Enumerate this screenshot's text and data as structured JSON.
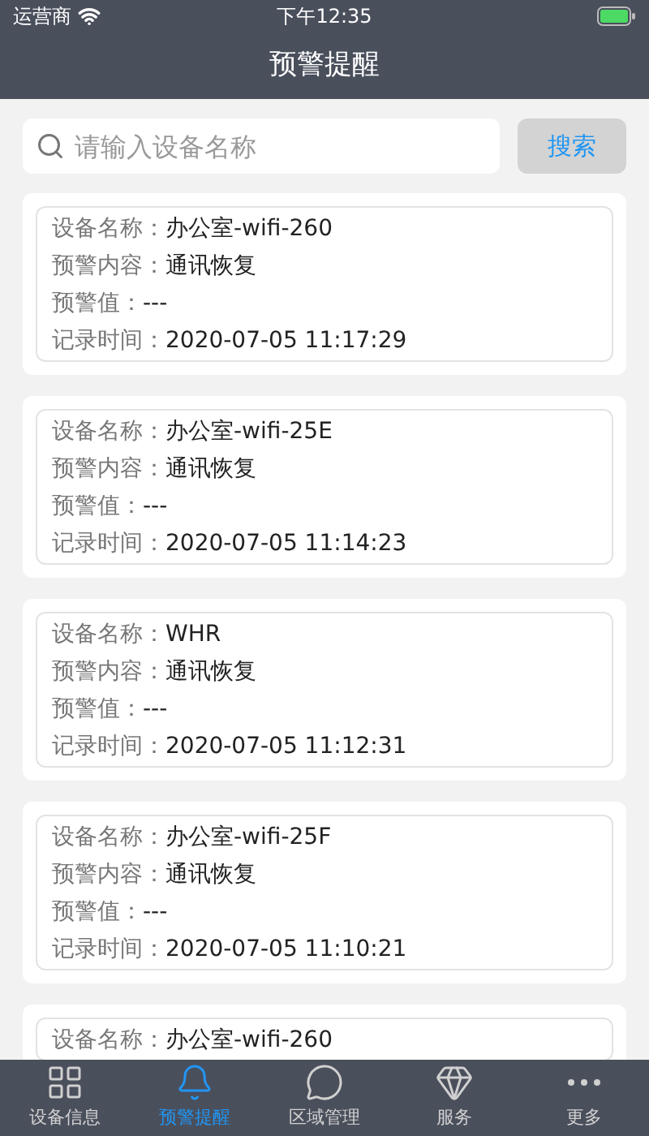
{
  "status_bar": {
    "carrier": "运营商",
    "time": "下午12:35"
  },
  "header": {
    "title": "预警提醒"
  },
  "search": {
    "placeholder": "请输入设备名称",
    "button": "搜索"
  },
  "alerts": [
    {
      "lines": [
        {
          "caption": "设备名称：",
          "text": "办公室-wifi-260"
        },
        {
          "caption": "预警内容：",
          "text": "通讯恢复"
        },
        {
          "caption": "预警值：",
          "text": "---"
        },
        {
          "caption": "记录时间：",
          "text": "2020-07-05 11:17:29"
        }
      ]
    },
    {
      "lines": [
        {
          "caption": "设备名称：",
          "text": "办公室-wifi-25E"
        },
        {
          "caption": "预警内容：",
          "text": "通讯恢复"
        },
        {
          "caption": "预警值：",
          "text": "---"
        },
        {
          "caption": "记录时间：",
          "text": "2020-07-05 11:14:23"
        }
      ]
    },
    {
      "lines": [
        {
          "caption": "设备名称：",
          "text": "WHR"
        },
        {
          "caption": "预警内容：",
          "text": "通讯恢复"
        },
        {
          "caption": "预警值：",
          "text": "---"
        },
        {
          "caption": "记录时间：",
          "text": "2020-07-05 11:12:31"
        }
      ]
    },
    {
      "lines": [
        {
          "caption": "设备名称：",
          "text": "办公室-wifi-25F"
        },
        {
          "caption": "预警内容：",
          "text": "通讯恢复"
        },
        {
          "caption": "预警值：",
          "text": "---"
        },
        {
          "caption": "记录时间：",
          "text": "2020-07-05 11:10:21"
        }
      ]
    },
    {
      "lines": [
        {
          "caption": "设备名称：",
          "text": "办公室-wifi-260"
        }
      ]
    }
  ],
  "tab_bar": [
    {
      "kind": "grid",
      "label": "设备信息",
      "selected": false
    },
    {
      "kind": "bell",
      "label": "预警提醒",
      "selected": true
    },
    {
      "kind": "chat",
      "label": "区域管理",
      "selected": false
    },
    {
      "kind": "diamond",
      "label": "服务",
      "selected": false
    },
    {
      "kind": "dots",
      "label": "更多",
      "selected": false
    }
  ]
}
